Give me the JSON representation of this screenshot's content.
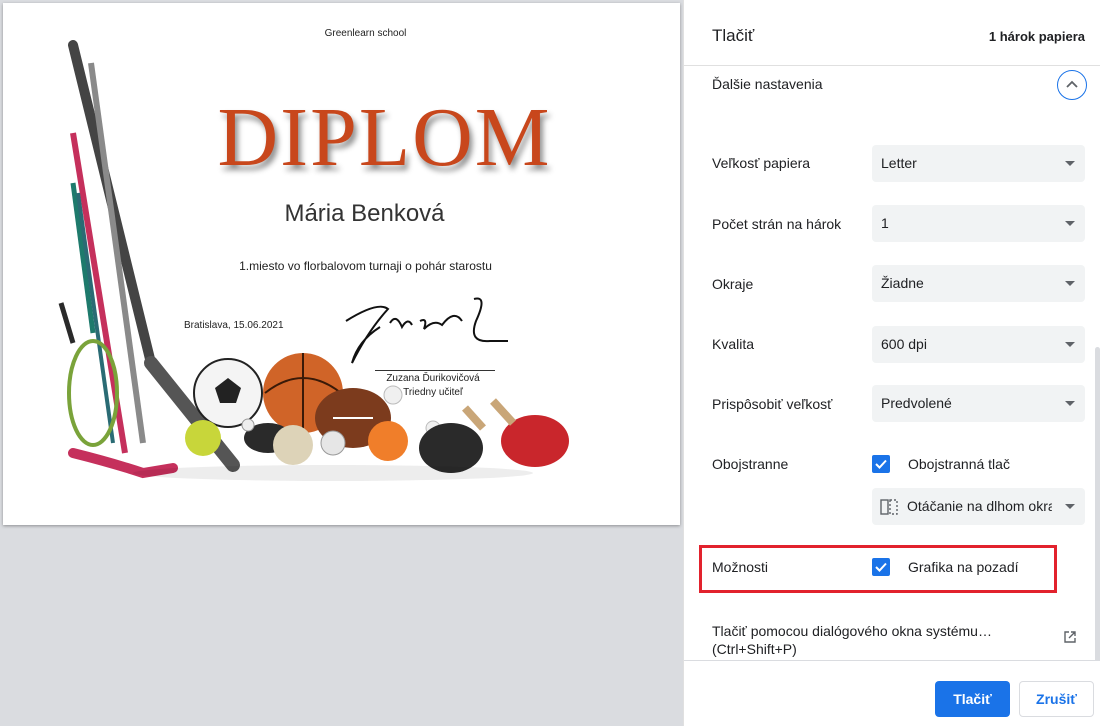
{
  "preview": {
    "school": "Greenlearn school",
    "title": "DIPLOM",
    "name": "Mária Benková",
    "achievement": "1.miesto vo florbalovom turnaji o pohár starostu",
    "place_date": "Bratislava, 15.06.2021",
    "signer_name": "Zuzana Ďurikovičová",
    "signer_role": "Triedny učiteľ"
  },
  "panel": {
    "title": "Tlačiť",
    "sheet_count": "1 hárok papiera",
    "more_settings": "Ďalšie nastavenia",
    "rows": {
      "paper_size": {
        "label": "Veľkosť papiera",
        "value": "Letter"
      },
      "pages_per_sheet": {
        "label": "Počet strán na hárok",
        "value": "1"
      },
      "margins": {
        "label": "Okraje",
        "value": "Žiadne"
      },
      "quality": {
        "label": "Kvalita",
        "value": "600 dpi"
      },
      "scale": {
        "label": "Prispôsobiť veľkosť",
        "value": "Predvolené"
      },
      "duplex": {
        "label": "Obojstranne",
        "checkbox_label": "Obojstranná tlač",
        "checked": true,
        "flip_value": "Otáčanie na dlhom okraji"
      },
      "options": {
        "label": "Možnosti",
        "checkbox_label": "Grafika na pozadí",
        "checked": true
      }
    },
    "system_dialog": "Tlačiť pomocou dialógového okna systému… (Ctrl+Shift+P)",
    "print_button": "Tlačiť",
    "cancel_button": "Zrušiť"
  },
  "colors": {
    "accent": "#1a73e8",
    "highlight": "#e2222d",
    "diplom_title": "#c8471c"
  },
  "icons": [
    "chevron-up-icon",
    "dropdown-caret-icon",
    "checkmark-icon",
    "flip-long-edge-icon",
    "open-external-icon"
  ]
}
